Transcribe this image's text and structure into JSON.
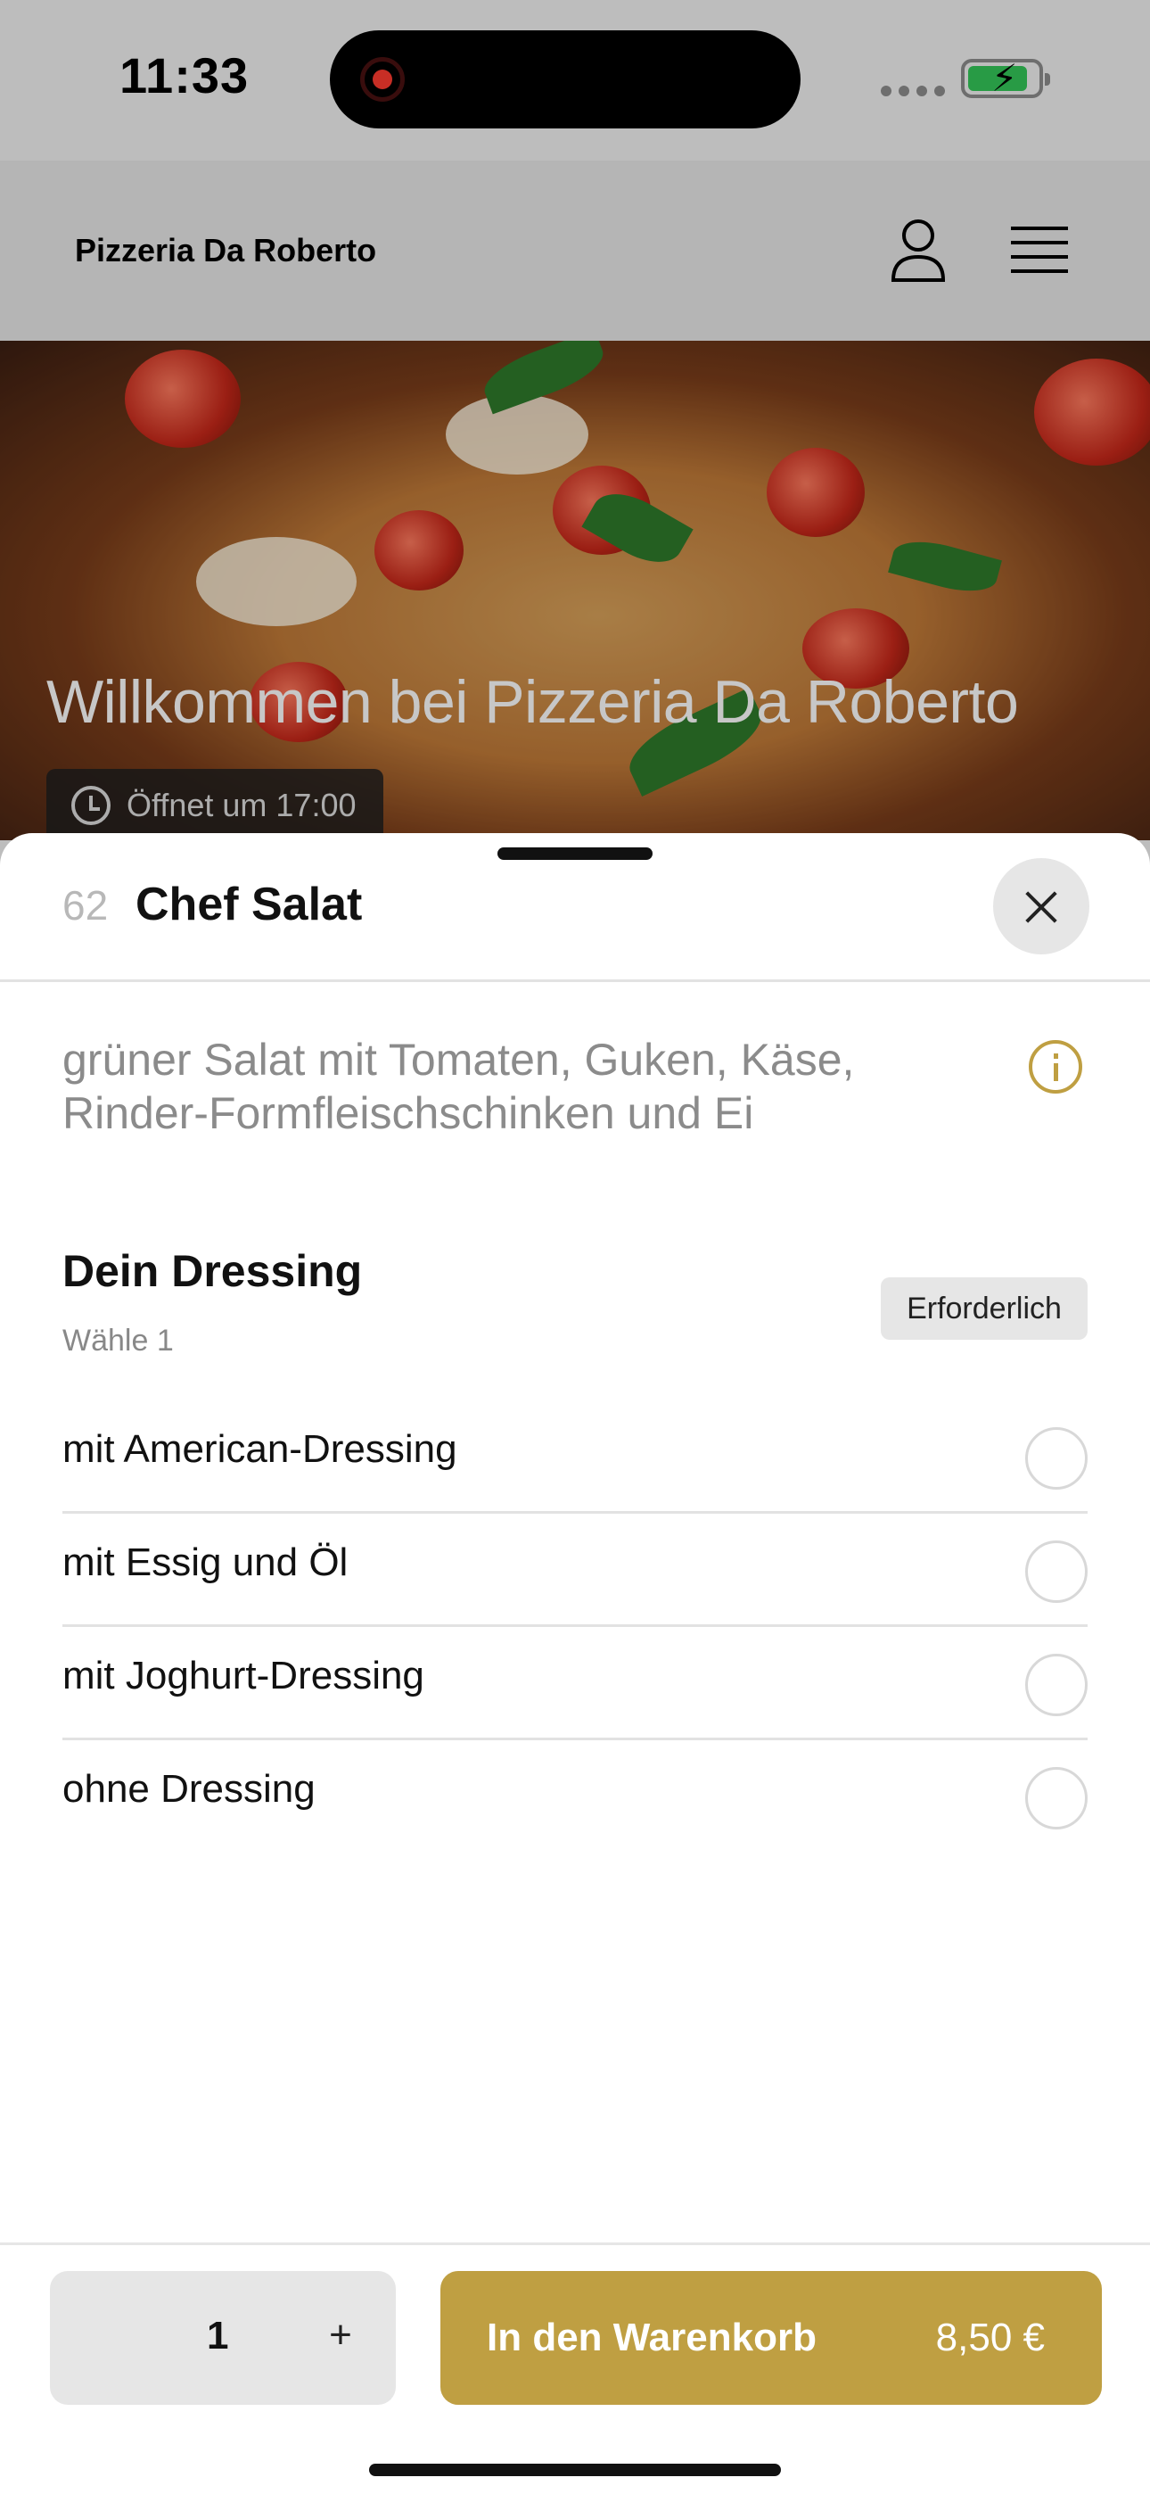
{
  "status_bar": {
    "time": "11:33"
  },
  "header": {
    "brand": "Pizzeria Da Roberto"
  },
  "hero": {
    "title": "Willkommen bei Pizzeria Da Roberto",
    "hours": "Öffnet um 17:00"
  },
  "item": {
    "number": "62",
    "title": "Chef Salat",
    "description": "grüner Salat mit Tomaten, Guken, Käse, Rinder-Formfleischschinken und Ei"
  },
  "options_group": {
    "title": "Dein Dressing",
    "subtitle": "Wähle 1",
    "badge": "Erforderlich",
    "options": [
      {
        "label": "mit American-Dressing"
      },
      {
        "label": "mit Essig und Öl"
      },
      {
        "label": "mit Joghurt-Dressing"
      },
      {
        "label": "ohne Dressing"
      }
    ]
  },
  "footer": {
    "quantity": "1",
    "plus": "+",
    "add_label": "In den Warenkorb",
    "price": "8,50 €"
  },
  "colors": {
    "accent": "#bf9f42",
    "badge_bg": "#e6e6e6"
  }
}
